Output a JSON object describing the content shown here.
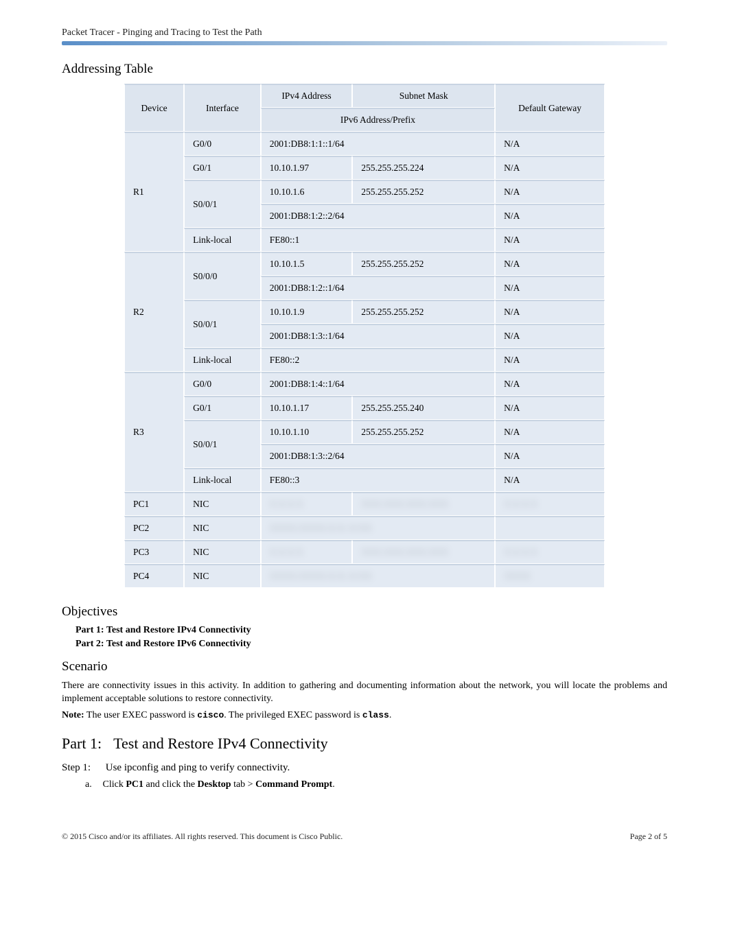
{
  "header": {
    "title": "Packet Tracer - Pinging and Tracing to Test the Path"
  },
  "sections": {
    "addressing_heading": "Addressing Table",
    "objectives_heading": "Objectives",
    "scenario_heading": "Scenario",
    "part1_num": "Part 1:",
    "part1_title": "Test and Restore IPv4 Connectivity",
    "step1_num": "Step 1:",
    "step1_title": "Use ipconfig and ping to verify connectivity.",
    "step1a_letter": "a.",
    "step1a_text_pre": "Click ",
    "step1a_pc1": "PC1",
    "step1a_text_mid1": " and click the ",
    "step1a_desktop": "Desktop",
    "step1a_text_mid2": " tab > ",
    "step1a_cmd": "Command Prompt",
    "step1a_text_end": "."
  },
  "table": {
    "headers": {
      "device": "Device",
      "interface": "Interface",
      "ipv4": "IPv4 Address",
      "mask": "Subnet Mask",
      "ipv6": "IPv6 Address/Prefix",
      "gateway": "Default Gateway"
    },
    "rows": [
      {
        "device": "R1",
        "interface": "G0/0",
        "ipv6": "2001:DB8:1:1::1/64",
        "gw": "N/A"
      },
      {
        "device": "",
        "interface": "G0/1",
        "ipv4": "10.10.1.97",
        "mask": "255.255.255.224",
        "gw": "N/A"
      },
      {
        "device": "",
        "interface": "S0/0/1",
        "ipv4": "10.10.1.6",
        "mask": "255.255.255.252",
        "gw": "N/A"
      },
      {
        "device": "",
        "interface": "",
        "ipv6": "2001:DB8:1:2::2/64",
        "gw": "N/A"
      },
      {
        "device": "",
        "interface": "Link-local",
        "ipv6": "FE80::1",
        "gw": "N/A"
      },
      {
        "device": "R2",
        "interface": "S0/0/0",
        "ipv4": "10.10.1.5",
        "mask": "255.255.255.252",
        "gw": "N/A"
      },
      {
        "device": "",
        "interface": "",
        "ipv6": "2001:DB8:1:2::1/64",
        "gw": "N/A"
      },
      {
        "device": "",
        "interface": "S0/0/1",
        "ipv4": "10.10.1.9",
        "mask": "255.255.255.252",
        "gw": "N/A"
      },
      {
        "device": "",
        "interface": "",
        "ipv6": "2001:DB8:1:3::1/64",
        "gw": "N/A"
      },
      {
        "device": "",
        "interface": "Link-local",
        "ipv6": "FE80::2",
        "gw": "N/A"
      },
      {
        "device": "R3",
        "interface": "G0/0",
        "ipv6": "2001:DB8:1:4::1/64",
        "gw": "N/A"
      },
      {
        "device": "",
        "interface": "G0/1",
        "ipv4": "10.10.1.17",
        "mask": "255.255.255.240",
        "gw": "N/A"
      },
      {
        "device": "",
        "interface": "S0/0/1",
        "ipv4": "10.10.1.10",
        "mask": "255.255.255.252",
        "gw": "N/A"
      },
      {
        "device": "",
        "interface": "",
        "ipv6": "2001:DB8:1:3::2/64",
        "gw": "N/A"
      },
      {
        "device": "",
        "interface": "Link-local",
        "ipv6": "FE80::3",
        "gw": "N/A"
      },
      {
        "device": "PC1",
        "interface": "NIC",
        "ipv4_blur": "X.X.X.X",
        "mask_blur": "XXX.XXX.XXX.XXX",
        "gw_blur": "X.X.X.X"
      },
      {
        "device": "PC2",
        "interface": "NIC",
        "ipv6_blur": "XXXX:XXXX:X:X::X/XX",
        "gw_blur": ""
      },
      {
        "device": "PC3",
        "interface": "NIC",
        "ipv4_blur": "X.X.X.X",
        "mask_blur": "XXX.XXX.XXX.XXX",
        "gw_blur": "X.X.X.X"
      },
      {
        "device": "PC4",
        "interface": "NIC",
        "ipv6_blur": "XXXX:XXXX:X:X::X/XX",
        "gw_blur": "XXXX"
      }
    ]
  },
  "objectives": {
    "p1": "Part 1: Test and Restore IPv4 Connectivity",
    "p2": "Part 2: Test and Restore IPv6 Connectivity"
  },
  "scenario": {
    "body": "There are connectivity issues in this activity. In addition to gathering and documenting information about the network, you will locate the problems and implement acceptable solutions to restore connectivity.",
    "note_pre": "Note:",
    "note_text1": "  The user EXEC password is ",
    "note_cisco": "cisco",
    "note_text2": ". The privileged EXEC password is ",
    "note_class": "class",
    "note_text3": "."
  },
  "footer": {
    "copyright": "© 2015 Cisco and/or its affiliates. All rights reserved. This document is Cisco Public.",
    "page": "Page 2 of 5"
  }
}
